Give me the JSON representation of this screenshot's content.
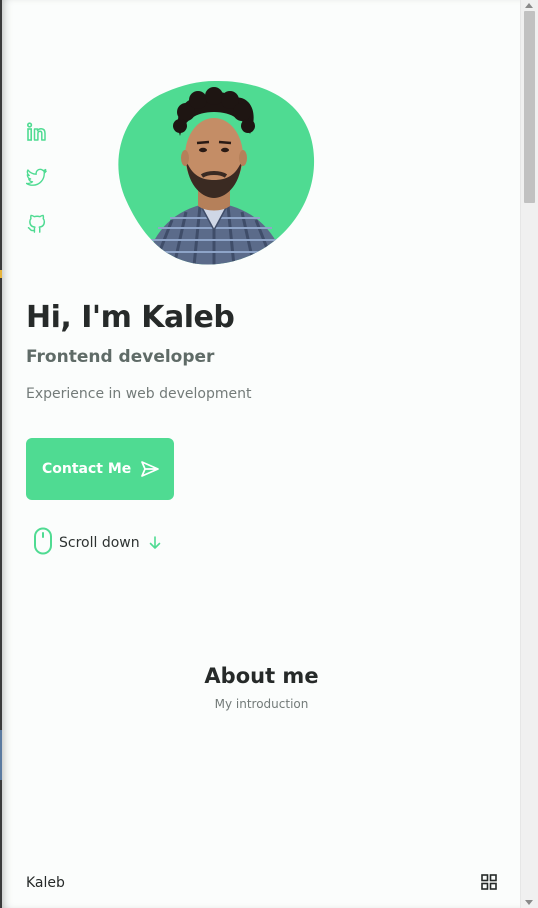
{
  "social": {
    "linkedin_icon": "linkedin-icon",
    "twitter_icon": "twitter-icon",
    "github_icon": "github-icon"
  },
  "home": {
    "title": "Hi, I'm Kaleb",
    "subtitle": "Frontend developer",
    "description": "Experience in web development",
    "contact_label": "Contact Me",
    "scroll_label": "Scroll down"
  },
  "about": {
    "title": "About me",
    "subtitle": "My introduction"
  },
  "nav": {
    "logo": "Kaleb"
  },
  "colors": {
    "accent": "#4fdb92",
    "title": "#262a29",
    "text": "#737b79",
    "background": "#fbfdfc"
  }
}
